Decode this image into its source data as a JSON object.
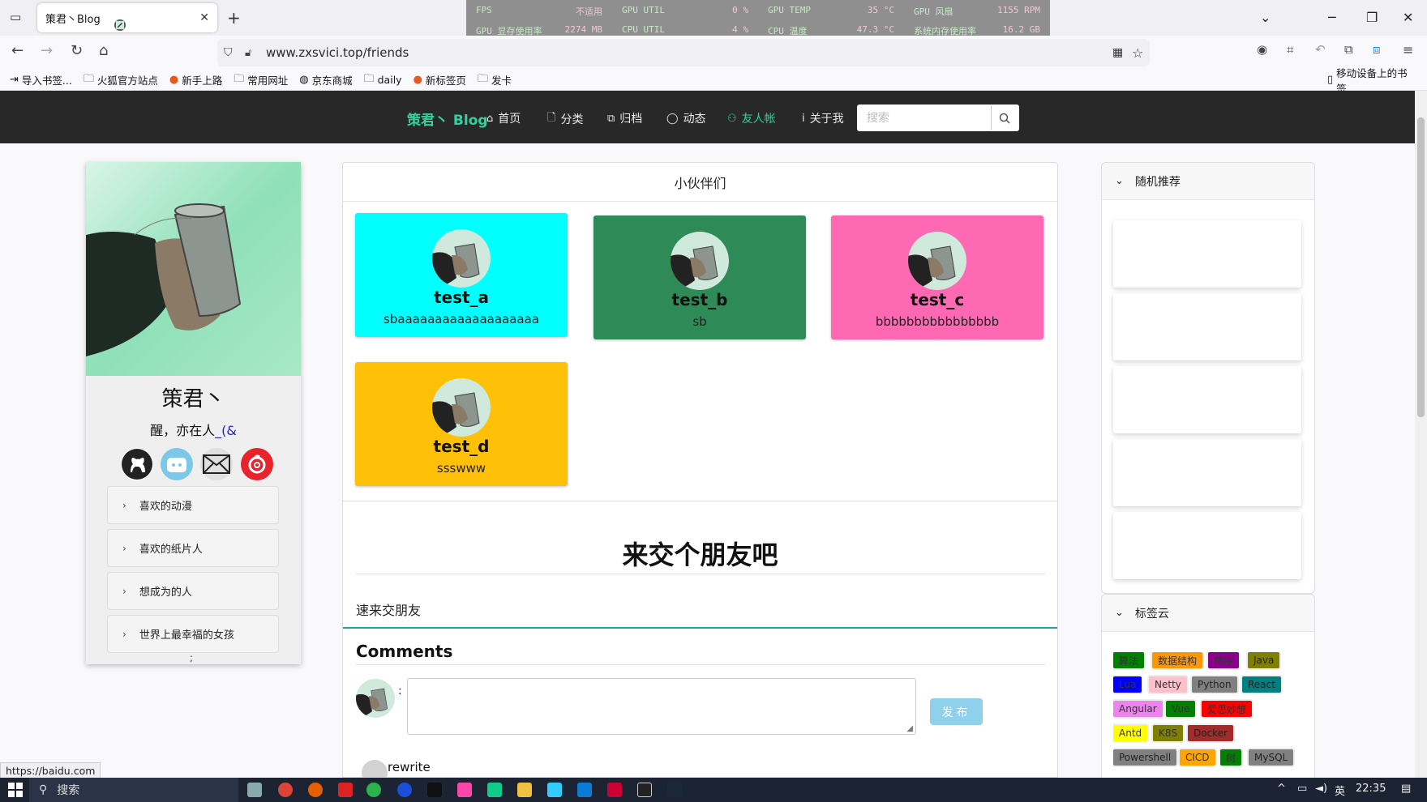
{
  "browser": {
    "tab_title": "策君丶Blog",
    "url": "www.zxsvici.top/friends",
    "bookmarks": [
      "导入书签...",
      "火狐官方站点",
      "新手上路",
      "常用网址",
      "京东商城",
      "daily",
      "新标签页",
      "发卡"
    ],
    "mobile_bookmarks": "移动设备上的书签",
    "status_url": "https://baidu.com"
  },
  "hw_overlay": [
    {
      "label": "FPS",
      "value": "不适用"
    },
    {
      "label": "GPU UTIL",
      "value": "0 %"
    },
    {
      "label": "GPU TEMP",
      "value": "35 °C"
    },
    {
      "label": "GPU 风扇",
      "value": "1155 RPM"
    },
    {
      "label": "GPU 显存使用率",
      "value": "2274 MB"
    },
    {
      "label": "CPU UTIL",
      "value": "4 %"
    },
    {
      "label": "CPU 温度",
      "value": "47.3 °C"
    },
    {
      "label": "系统内存使用率",
      "value": "16.2 GB"
    }
  ],
  "site": {
    "brand": "策君丶 Blog",
    "nav": [
      {
        "label": "首页",
        "icon": "home-icon"
      },
      {
        "label": "分类",
        "icon": "file-icon"
      },
      {
        "label": "归档",
        "icon": "archive-icon"
      },
      {
        "label": "动态",
        "icon": "chat-icon"
      },
      {
        "label": "友人帐",
        "icon": "users-icon",
        "active": true
      },
      {
        "label": "关于我",
        "icon": "info-icon"
      }
    ],
    "search_placeholder": "搜索"
  },
  "profile": {
    "name": "策君丶",
    "bio": "醒，亦在人",
    "bio_link": "_(&",
    "menu": [
      "喜欢的动漫",
      "喜欢的纸片人",
      "想成为的人",
      "世界上最幸福的女孩"
    ],
    "footer_char": ";"
  },
  "friends": {
    "header": "小伙伴们",
    "cards": [
      {
        "name": "test_a",
        "desc": "sbaaaaaaaaaaaaaaaaaaa",
        "color": "#00ffff"
      },
      {
        "name": "test_b",
        "desc": "sb",
        "color": "#2e8b57"
      },
      {
        "name": "test_c",
        "desc": "bbbbbbbbbbbbbbbb",
        "color": "#ff69b4"
      },
      {
        "name": "test_d",
        "desc": "ssswww",
        "color": "#ffc107"
      }
    ]
  },
  "article": {
    "title": "来交个朋友吧",
    "subtitle": "速来交朋友"
  },
  "comments": {
    "title": "Comments",
    "colon": ":",
    "publish_label": "发布",
    "first_user": "rewrite"
  },
  "sidebar": {
    "random_title": "随机推荐",
    "tags_title": "标签云",
    "tags": [
      {
        "label": "算法",
        "bg": "#008000",
        "fg": "#333"
      },
      {
        "label": "数据结构",
        "bg": "#ff9800",
        "fg": "#333"
      },
      {
        "label": "排序",
        "bg": "#8b008b",
        "fg": "#333"
      },
      {
        "label": "Java",
        "bg": "#808000",
        "fg": "#222"
      },
      {
        "label": "Lua",
        "bg": "#0000ff",
        "fg": "#333"
      },
      {
        "label": "Netty",
        "bg": "#ffc0cb",
        "fg": "#333"
      },
      {
        "label": "Python",
        "bg": "#808080",
        "fg": "#222"
      },
      {
        "label": "React",
        "bg": "#008080",
        "fg": "#222"
      },
      {
        "label": "Angular",
        "bg": "#ee82ee",
        "fg": "#333"
      },
      {
        "label": "Vue",
        "bg": "#008000",
        "fg": "#333"
      },
      {
        "label": "爱思妙想",
        "bg": "#ff0000",
        "fg": "#333"
      },
      {
        "label": "Antd",
        "bg": "#ffff00",
        "fg": "#333"
      },
      {
        "label": "K8S",
        "bg": "#808000",
        "fg": "#333"
      },
      {
        "label": "Docker",
        "bg": "#a52a2a",
        "fg": "#222"
      },
      {
        "label": "Powershell",
        "bg": "#808080",
        "fg": "#222"
      },
      {
        "label": "CICD",
        "bg": "#ffa500",
        "fg": "#333"
      },
      {
        "label": "树",
        "bg": "#008000",
        "fg": "#333"
      },
      {
        "label": "MySQL",
        "bg": "#808080",
        "fg": "#222"
      }
    ]
  },
  "taskbar": {
    "search_label": "搜索",
    "ime": "英",
    "time": "22:35"
  }
}
